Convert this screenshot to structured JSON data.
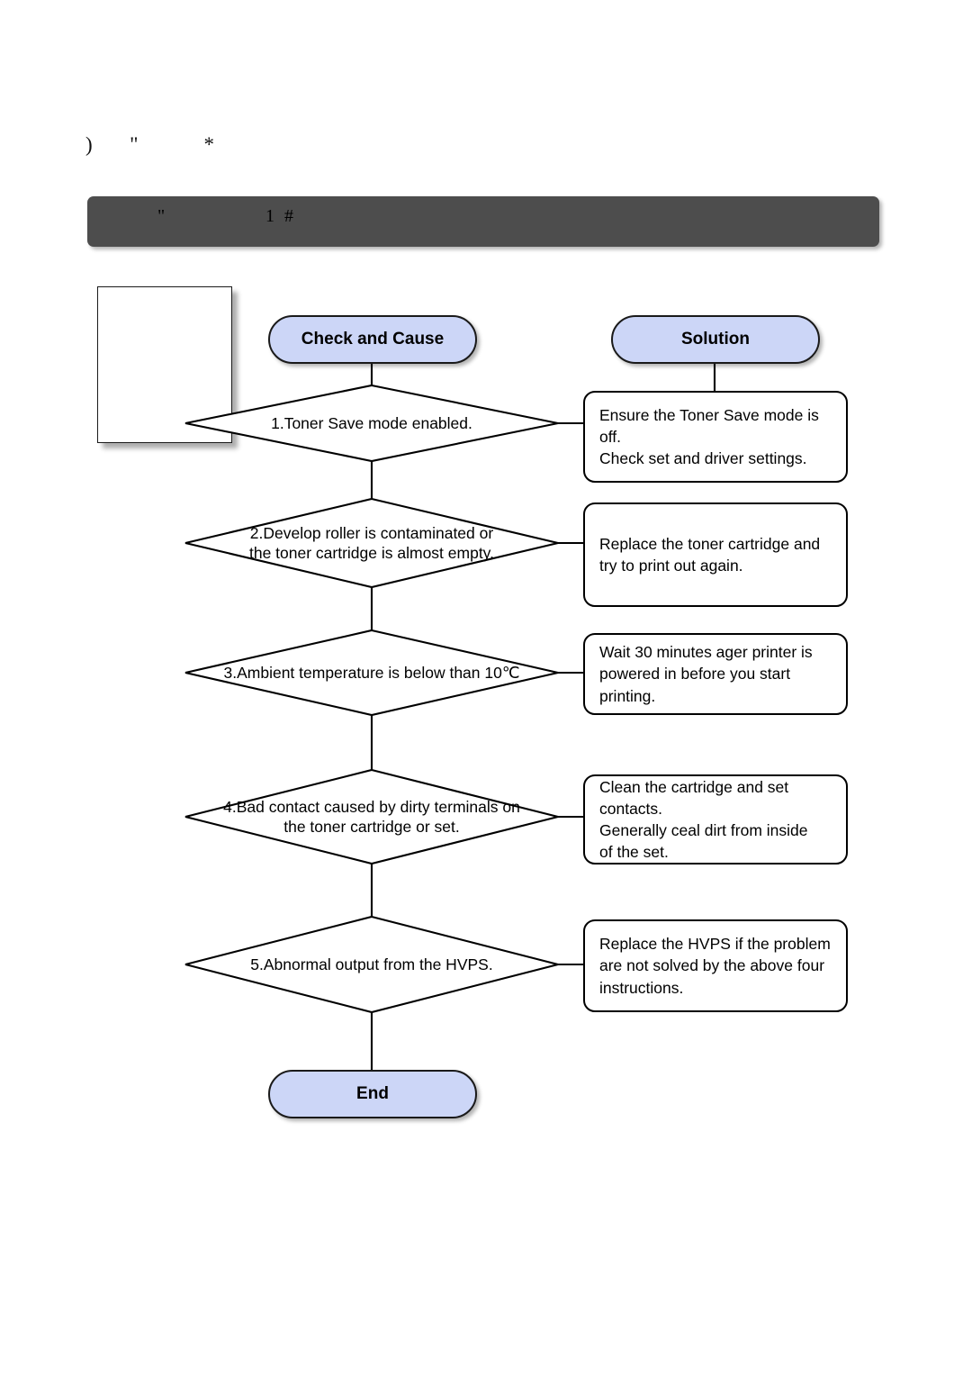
{
  "header": {
    "glyph_line": ")  \"    *",
    "bar_text_left": "\"",
    "bar_text_right": "1 #"
  },
  "flow": {
    "start_left_label": "Check and Cause",
    "start_right_label": "Solution",
    "end_label": "End",
    "steps": [
      {
        "id": 1,
        "cause": "1.Toner Save mode enabled.",
        "solution": "Ensure the Toner Save mode is off.\nCheck set and driver settings."
      },
      {
        "id": 2,
        "cause": "2.Develop roller is contaminated or\nthe toner cartridge is almost empty.",
        "solution": "Replace the toner cartridge and\ntry to print out again."
      },
      {
        "id": 3,
        "cause": "3.Ambient temperature is below than 10℃",
        "solution": "Wait 30 minutes ager printer is\n powered in before you start printing."
      },
      {
        "id": 4,
        "cause": "4.Bad contact caused by dirty terminals on\nthe toner cartridge or set.",
        "solution": "Clean the cartridge and set contacts.\n Generally ceal dirt from inside\nof the set."
      },
      {
        "id": 5,
        "cause": "5.Abnormal output from the HVPS.",
        "solution": "Replace the HVPS if the problem\n are not solved by the above four\n instructions."
      }
    ]
  },
  "colors": {
    "oval_fill": "#ccd6f7",
    "titlebar_bg": "#4d4d4d",
    "line": "#000000",
    "box_fill": "#ffffff"
  }
}
